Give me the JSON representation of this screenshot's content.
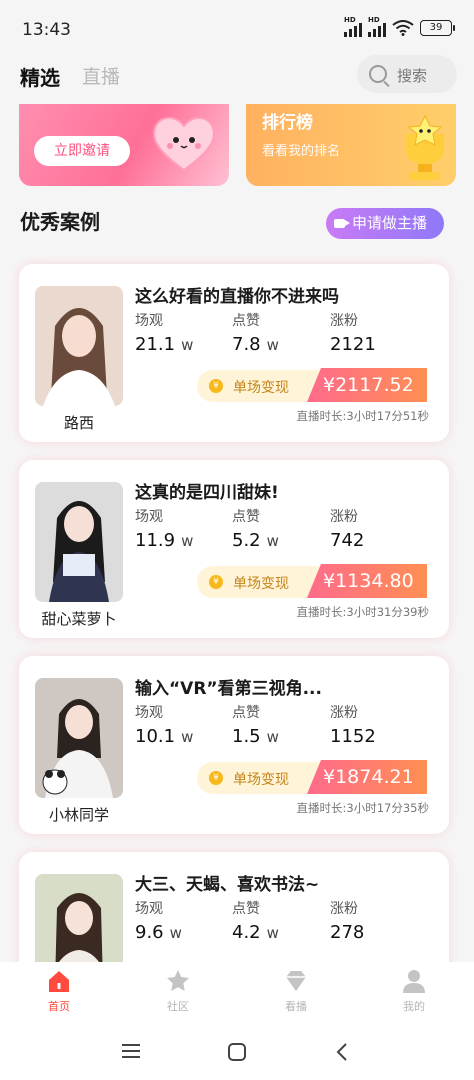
{
  "status_bar": {
    "time": "13:43",
    "battery": "39",
    "signal_label": "HD"
  },
  "top_tabs": {
    "active": "精选",
    "inactive": "直播",
    "search_placeholder": "搜索"
  },
  "banners": {
    "invite": {
      "button_label": "立即邀请"
    },
    "ranking": {
      "title": "排行榜",
      "subtitle": "看看我的排名"
    }
  },
  "section": {
    "title": "优秀案例",
    "apply_button": "申请做主播"
  },
  "stat_labels": {
    "views": "场观",
    "likes": "点赞",
    "followers": "涨粉"
  },
  "earn_label": "单场变现",
  "cases": [
    {
      "name": "路西",
      "title": "这么好看的直播你不进来吗",
      "views": "21.1",
      "views_unit": "w",
      "likes": "7.8",
      "likes_unit": "w",
      "followers": "2121",
      "amount": "¥2117.52",
      "duration": "直播时长:3小时17分51秒"
    },
    {
      "name": "甜心菜萝卜",
      "title": "这真的是四川甜妹!",
      "views": "11.9",
      "views_unit": "w",
      "likes": "5.2",
      "likes_unit": "w",
      "followers": "742",
      "amount": "¥1134.80",
      "duration": "直播时长:3小时31分39秒"
    },
    {
      "name": "小林同学",
      "title": "输入“VR”看第三视角...",
      "views": "10.1",
      "views_unit": "w",
      "likes": "1.5",
      "likes_unit": "w",
      "followers": "1152",
      "amount": "¥1874.21",
      "duration": "直播时长:3小时17分35秒"
    },
    {
      "name": "",
      "title": "大三、天蝎、喜欢书法~",
      "views": "9.6",
      "views_unit": "w",
      "likes": "4.2",
      "likes_unit": "w",
      "followers": "278",
      "amount": "",
      "duration": ""
    }
  ],
  "bottom_nav": [
    {
      "label": "首页",
      "icon": "home-icon",
      "active": true
    },
    {
      "label": "社区",
      "icon": "star-icon",
      "active": false
    },
    {
      "label": "看播",
      "icon": "diamond-icon",
      "active": false
    },
    {
      "label": "我的",
      "icon": "user-icon",
      "active": false
    }
  ],
  "colors": {
    "accent": "#ff4a3d",
    "purple": "#9b79f7",
    "earn": "#ff7a6a"
  }
}
